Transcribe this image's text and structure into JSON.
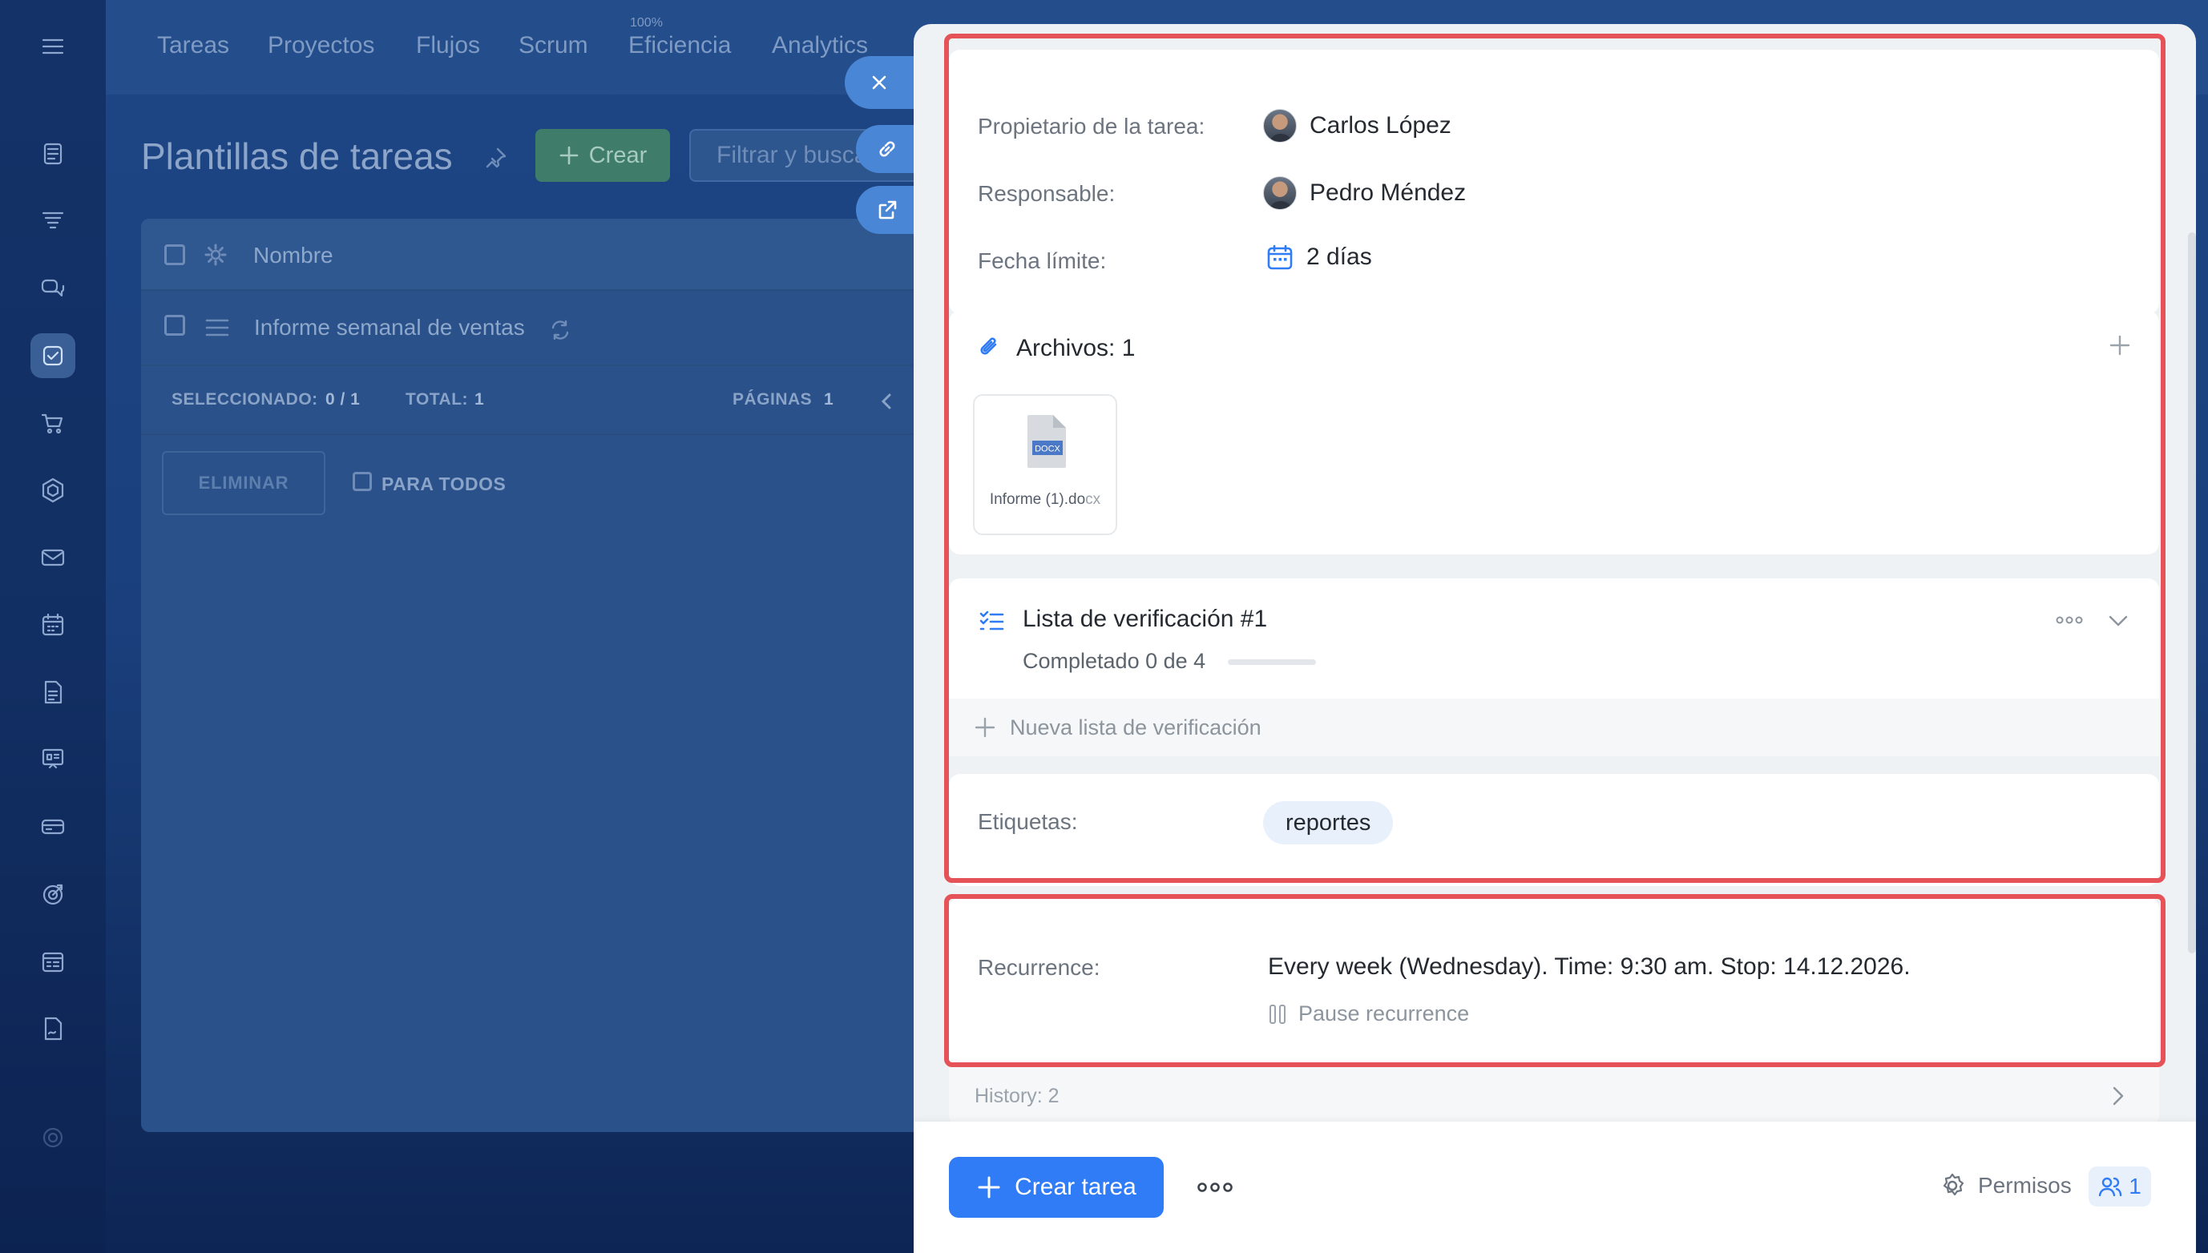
{
  "topnav": {
    "items": [
      "Tareas",
      "Proyectos",
      "Flujos",
      "Scrum",
      "Eficiencia",
      "Analytics"
    ],
    "efficiency_badge": "100%"
  },
  "page": {
    "title": "Plantillas de tareas",
    "create_label": "Crear",
    "filter_placeholder": "Filtrar y buscar"
  },
  "list": {
    "header_name": "Nombre",
    "rows": [
      {
        "name": "Informe semanal de ventas"
      }
    ],
    "footer": {
      "selected_label": "SELECCIONADO:",
      "selected_value": "0 / 1",
      "total_label": "TOTAL:",
      "total_value": "1",
      "pages_label": "PÁGINAS",
      "pages_value": "1"
    },
    "delete_label": "ELIMINAR",
    "for_all_label": "PARA TODOS"
  },
  "task": {
    "owner_label": "Propietario de la tarea:",
    "owner": "Carlos López",
    "responsible_label": "Responsable:",
    "responsible": "Pedro Méndez",
    "deadline_label": "Fecha límite:",
    "deadline": "2 días",
    "files_title": "Archivos: 1",
    "file": {
      "name": "Informe (1).do",
      "ext": "cx",
      "badge": "DOCX"
    },
    "checklist_title": "Lista de verificación #1",
    "checklist_progress": "Completado 0 de 4",
    "checklist_done_fraction": 0,
    "new_checklist": "Nueva lista de verificación",
    "tags_label": "Etiquetas:",
    "tags": [
      "reportes"
    ],
    "recurrence_label": "Recurrence:",
    "recurrence_value": "Every week (Wednesday). Time: 9:30 am. Stop: 14.12.2026.",
    "pause_label": "Pause recurrence",
    "history": "History: 2"
  },
  "bottom": {
    "create_task_label": "Crear tarea",
    "permissions_label": "Permisos",
    "members_count": "1"
  },
  "colors": {
    "accent": "#2f7cf6",
    "highlight": "#e55257",
    "panel_bg": "#eef2f4",
    "tag_bg": "#e8f1fb"
  }
}
